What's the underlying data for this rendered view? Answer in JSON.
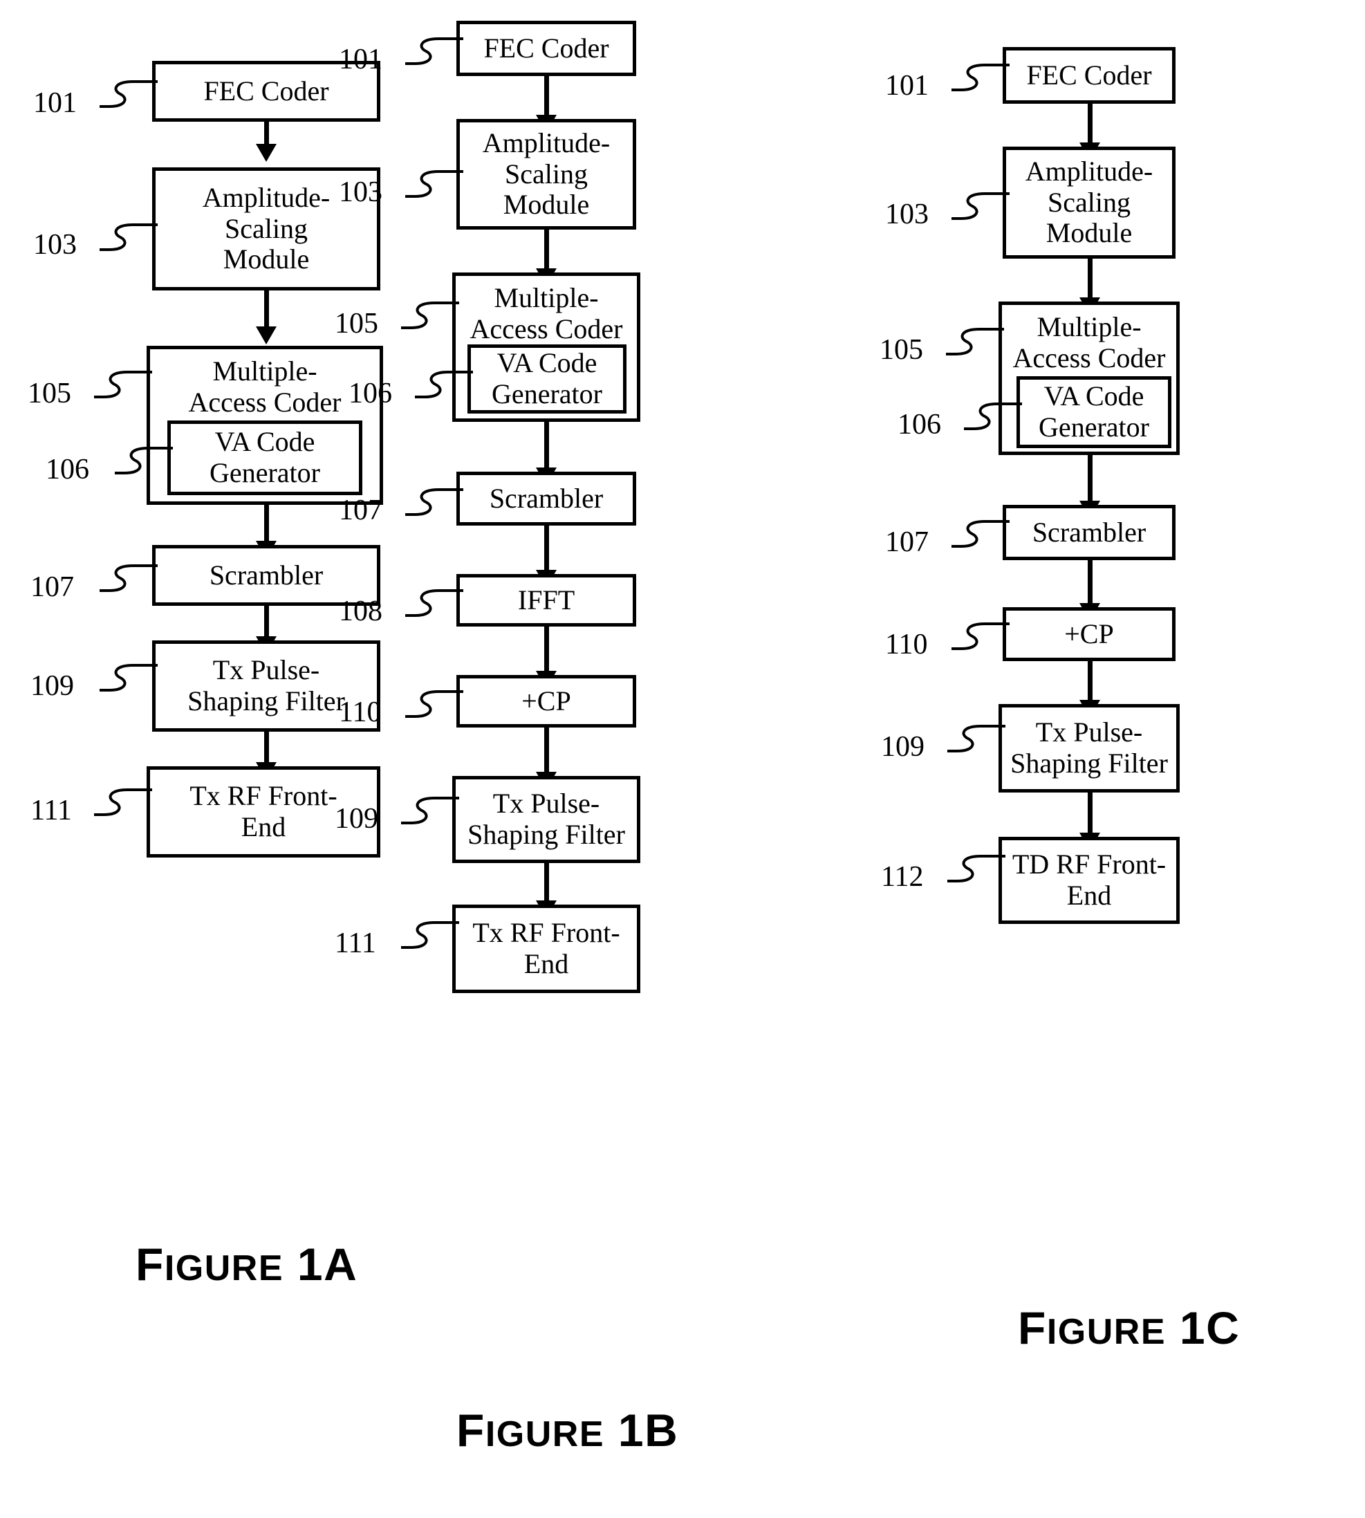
{
  "document": {
    "kind": "patent-block-diagram",
    "figures": [
      {
        "id": "fig1a",
        "caption": "Figure 1A",
        "caption_first": "F",
        "caption_rest": "IGURE",
        "caption_suffix": "1A",
        "blocks": [
          {
            "ref": "101",
            "label": "FEC Coder"
          },
          {
            "ref": "103",
            "label": "Amplitude-\nScaling\nModule"
          },
          {
            "ref": "105",
            "label": "Multiple-\nAccess Coder"
          },
          {
            "ref": "106",
            "label": "VA Code\nGenerator",
            "nested_in": "105"
          },
          {
            "ref": "107",
            "label": "Scrambler"
          },
          {
            "ref": "109",
            "label": "Tx Pulse-\nShaping Filter"
          },
          {
            "ref": "111",
            "label": "Tx RF Front-\nEnd"
          }
        ]
      },
      {
        "id": "fig1b",
        "caption": "Figure 1B",
        "caption_first": "F",
        "caption_rest": "IGURE",
        "caption_suffix": "1B",
        "blocks": [
          {
            "ref": "101",
            "label": "FEC Coder"
          },
          {
            "ref": "103",
            "label": "Amplitude-\nScaling\nModule"
          },
          {
            "ref": "105",
            "label": "Multiple-\nAccess Coder"
          },
          {
            "ref": "106",
            "label": "VA Code\nGenerator",
            "nested_in": "105"
          },
          {
            "ref": "107",
            "label": "Scrambler"
          },
          {
            "ref": "108",
            "label": "IFFT"
          },
          {
            "ref": "110",
            "label": "+CP"
          },
          {
            "ref": "109",
            "label": "Tx Pulse-\nShaping Filter"
          },
          {
            "ref": "111",
            "label": "Tx RF Front-\nEnd"
          }
        ]
      },
      {
        "id": "fig1c",
        "caption": "Figure 1C",
        "caption_first": "F",
        "caption_rest": "IGURE",
        "caption_suffix": "1C",
        "blocks": [
          {
            "ref": "101",
            "label": "FEC Coder"
          },
          {
            "ref": "103",
            "label": "Amplitude-\nScaling\nModule"
          },
          {
            "ref": "105",
            "label": "Multiple-\nAccess Coder"
          },
          {
            "ref": "106",
            "label": "VA Code\nGenerator",
            "nested_in": "105"
          },
          {
            "ref": "107",
            "label": "Scrambler"
          },
          {
            "ref": "110",
            "label": "+CP"
          },
          {
            "ref": "109",
            "label": "Tx Pulse-\nShaping Filter"
          },
          {
            "ref": "112",
            "label": "TD RF Front-\nEnd"
          }
        ]
      }
    ]
  },
  "fig1a": {
    "b101": "FEC Coder",
    "b103": "Amplitude-\nScaling\nModule",
    "b105": "Multiple-\nAccess Coder",
    "b106": "VA Code\nGenerator",
    "b107": "Scrambler",
    "b109": "Tx Pulse-\nShaping Filter",
    "b111": "Tx RF Front-\nEnd",
    "r101": "101",
    "r103": "103",
    "r105": "105",
    "r106": "106",
    "r107": "107",
    "r109": "109",
    "r111": "111",
    "cap_first": "F",
    "cap_rest": "IGURE",
    "cap_suffix": "1A"
  },
  "fig1b": {
    "b101": "FEC Coder",
    "b103": "Amplitude-\nScaling\nModule",
    "b105": "Multiple-\nAccess Coder",
    "b106": "VA Code\nGenerator",
    "b107": "Scrambler",
    "b108": "IFFT",
    "b110": "+CP",
    "b109": "Tx Pulse-\nShaping Filter",
    "b111": "Tx RF Front-\nEnd",
    "r101": "101",
    "r103": "103",
    "r105": "105",
    "r106": "106",
    "r107": "107",
    "r108": "108",
    "r110": "110",
    "r109": "109",
    "r111": "111",
    "cap_first": "F",
    "cap_rest": "IGURE",
    "cap_suffix": "1B"
  },
  "fig1c": {
    "b101": "FEC Coder",
    "b103": "Amplitude-\nScaling\nModule",
    "b105": "Multiple-\nAccess Coder",
    "b106": "VA Code\nGenerator",
    "b107": "Scrambler",
    "b110": "+CP",
    "b109": "Tx Pulse-\nShaping Filter",
    "b112": "TD RF Front-\nEnd",
    "r101": "101",
    "r103": "103",
    "r105": "105",
    "r106": "106",
    "r107": "107",
    "r110": "110",
    "r109": "109",
    "r112": "112",
    "cap_first": "F",
    "cap_rest": "IGURE",
    "cap_suffix": "1C"
  },
  "colors": {
    "ink": "#000000",
    "paper": "#ffffff"
  }
}
